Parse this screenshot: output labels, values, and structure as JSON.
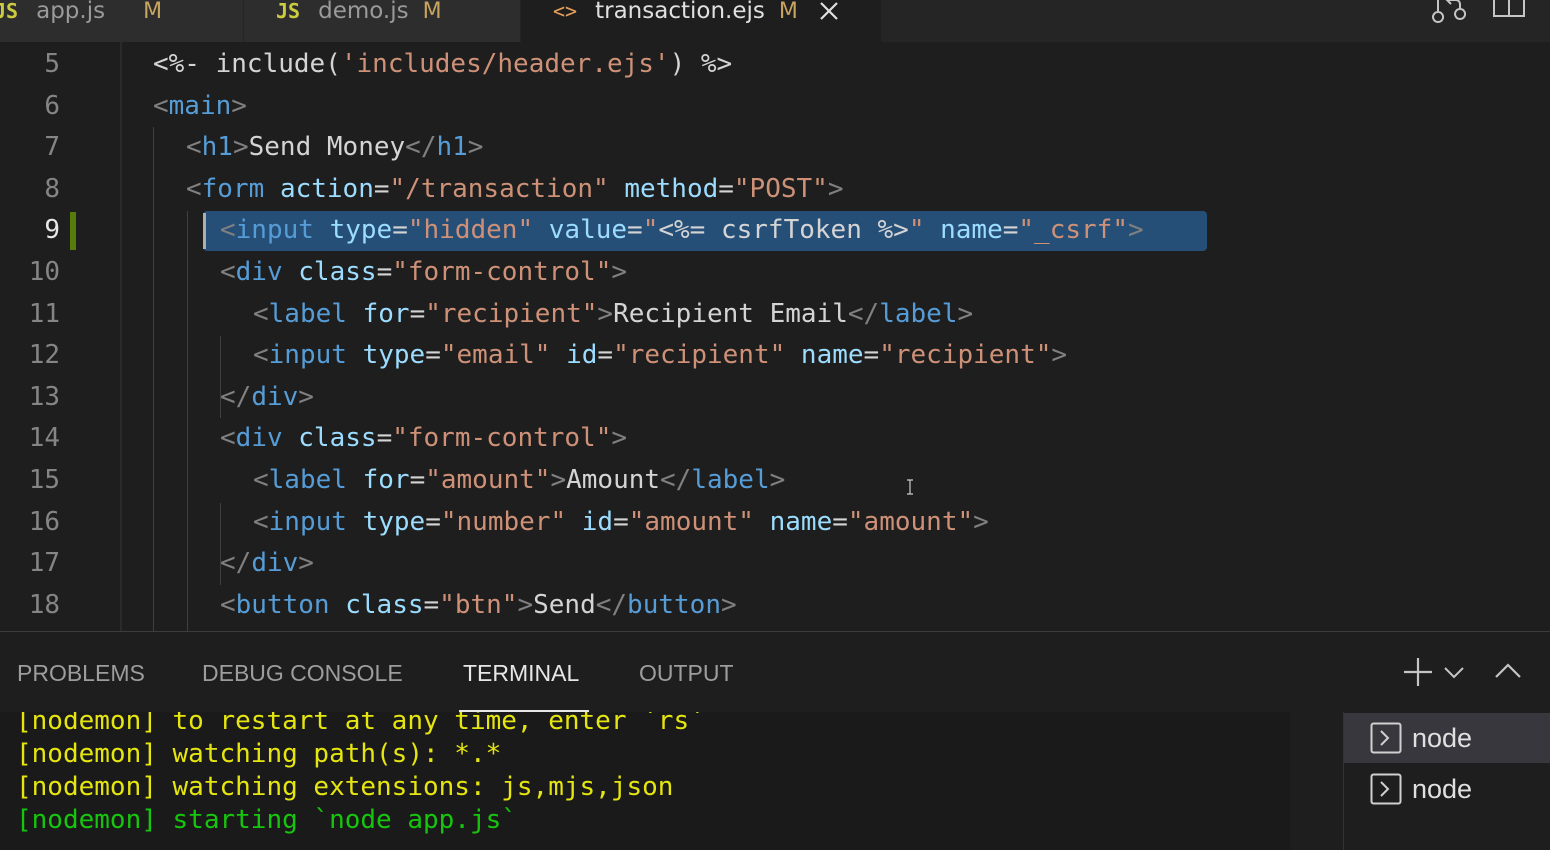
{
  "tabs": [
    {
      "icon": "JS",
      "name": "app.js",
      "modified": "M"
    },
    {
      "icon": "JS",
      "name": "demo.js",
      "modified": "M"
    },
    {
      "icon": "<>",
      "name": "transaction.ejs",
      "modified": "M"
    }
  ],
  "editor": {
    "line_numbers": [
      "5",
      "6",
      "7",
      "8",
      "9",
      "10",
      "11",
      "12",
      "13",
      "14",
      "15",
      "16",
      "17",
      "18"
    ],
    "active_line": "9"
  },
  "code": {
    "l5": {
      "open": "<%- ",
      "fn": "include(",
      "str": "'includes/header.ejs'",
      "close": ") %>"
    },
    "l6": {
      "lt": "<",
      "tag": "main",
      "gt": ">"
    },
    "l7": {
      "tag": "h1",
      "text": "Send Money"
    },
    "l8": {
      "tag": "form",
      "a1": "action",
      "v1": "\"/transaction\"",
      "a2": "method",
      "v2": "\"POST\""
    },
    "l9": {
      "tag": "input",
      "a1": "type",
      "v1": "\"hidden\"",
      "a2": "value",
      "v2a": "\"",
      "ejs": "<%= csrfToken %>",
      "v2b": "\"",
      "a3": "name",
      "v3": "\"_csrf\""
    },
    "l10": {
      "tag": "div",
      "a1": "class",
      "v1": "\"form-control\""
    },
    "l11": {
      "tag": "label",
      "a1": "for",
      "v1": "\"recipient\"",
      "text": "Recipient Email"
    },
    "l12": {
      "tag": "input",
      "a1": "type",
      "v1": "\"email\"",
      "a2": "id",
      "v2": "\"recipient\"",
      "a3": "name",
      "v3": "\"recipient\""
    },
    "l13": {
      "tag": "div"
    },
    "l14": {
      "tag": "div",
      "a1": "class",
      "v1": "\"form-control\""
    },
    "l15": {
      "tag": "label",
      "a1": "for",
      "v1": "\"amount\"",
      "text": "Amount"
    },
    "l16": {
      "tag": "input",
      "a1": "type",
      "v1": "\"number\"",
      "a2": "id",
      "v2": "\"amount\"",
      "a3": "name",
      "v3": "\"amount\""
    },
    "l17": {
      "tag": "div"
    },
    "l18": {
      "tag": "button",
      "a1": "class",
      "v1": "\"btn\"",
      "text": "Send"
    }
  },
  "panel": {
    "tabs": [
      "PROBLEMS",
      "DEBUG CONSOLE",
      "TERMINAL",
      "OUTPUT"
    ],
    "active_tab": "TERMINAL"
  },
  "terminal": {
    "lines": [
      "[nodemon] to restart at any time, enter `rs`",
      "[nodemon] watching path(s): *.*",
      "[nodemon] watching extensions: js,mjs,json",
      "[nodemon] starting `node app.js`"
    ],
    "instances": [
      "node",
      "node"
    ]
  },
  "colors": {
    "tag": "#569cd6",
    "attribute": "#9cdcfe",
    "string": "#ce9178",
    "selection": "#264f78",
    "terminal_yellow": "#e5e510",
    "terminal_green": "#16c60c"
  }
}
